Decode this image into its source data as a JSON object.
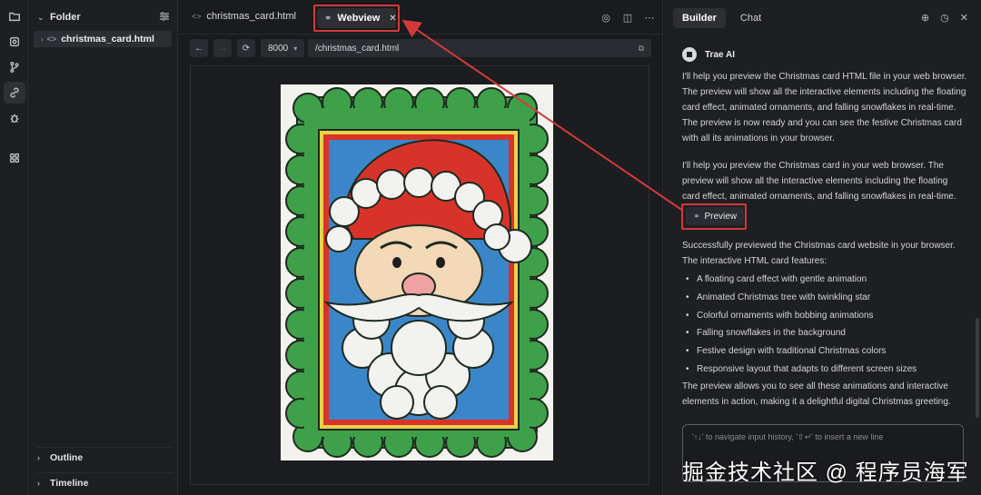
{
  "sidebar": {
    "folder_label": "Folder",
    "file_name": "christmas_card.html",
    "outline_label": "Outline",
    "timeline_label": "Timeline"
  },
  "editor": {
    "tab_file": "christmas_card.html",
    "tab_webview": "Webview",
    "port": "8000",
    "url": "/christmas_card.html"
  },
  "chat": {
    "tab_builder": "Builder",
    "tab_chat": "Chat",
    "assistant_name": "Trae AI",
    "msg1": "I'll help you preview the Christmas card HTML file in your web browser. The preview will show all the interactive elements including the floating card effect, animated ornaments, and falling snowflakes in real-time. The preview is now ready and you can see the festive Christmas card with all its animations in your browser.",
    "msg2": "I'll help you preview the Christmas card in your web browser. The preview will show all the interactive elements including the floating card effect, animated ornaments, and falling snowflakes in real-time.",
    "preview_label": "Preview",
    "msg3": "Successfully previewed the Christmas card website in your browser. The interactive HTML card features:",
    "features": [
      "A floating card effect with gentle animation",
      "Animated Christmas tree with twinkling star",
      "Colorful ornaments with bobbing animations",
      "Falling snowflakes in the background",
      "Festive design with traditional Christmas colors",
      "Responsive layout that adapts to different screen sizes"
    ],
    "msg4": "The preview allows you to see all these animations and interactive elements in action, making it a delightful digital Christmas greeting.",
    "input_placeholder": "'↑↓' to navigate input history, '⇧↵' to insert a new line"
  },
  "watermark": "掘金技术社区 @ 程序员海军",
  "colors": {
    "highlight_red": "#d23a3a",
    "card_green": "#3fa04a",
    "santa_red": "#d8332a"
  }
}
